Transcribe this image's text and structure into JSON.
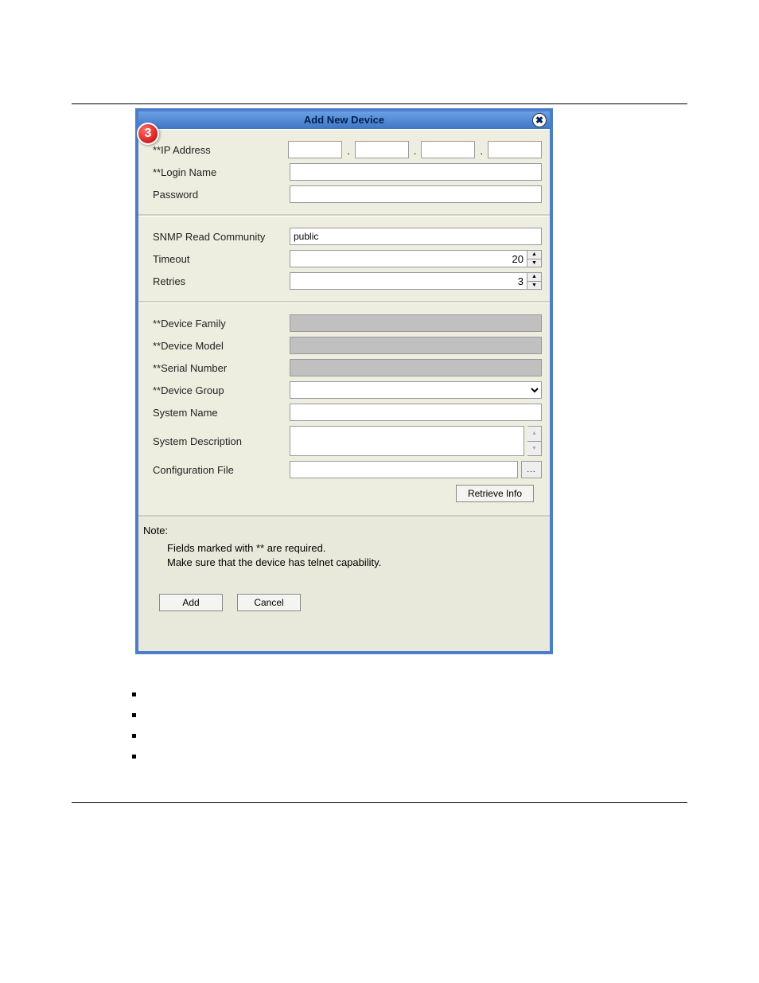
{
  "dialog": {
    "title": "Add New Device",
    "badge": "3",
    "close_label": "✖",
    "section1": {
      "ip_label": "**IP Address",
      "login_label": "**Login Name",
      "password_label": "Password",
      "ip": [
        "",
        "",
        "",
        ""
      ],
      "login": "",
      "password": ""
    },
    "section2": {
      "snmp_label": "SNMP Read Community",
      "snmp_value": "public",
      "timeout_label": "Timeout",
      "timeout_value": "20",
      "retries_label": "Retries",
      "retries_value": "3"
    },
    "section3": {
      "family_label": "**Device Family",
      "model_label": "**Device Model",
      "serial_label": "**Serial Number",
      "group_label": "**Device Group",
      "sysname_label": "System Name",
      "sysdesc_label": "System Description",
      "config_label": "Configuration File",
      "browse_label": "...",
      "retrieve_label": "Retrieve Info"
    },
    "note": {
      "title": "Note:",
      "line1": "Fields marked with ** are required.",
      "line2": "Make sure that the device has telnet capability."
    },
    "add_label": "Add",
    "cancel_label": "Cancel"
  }
}
